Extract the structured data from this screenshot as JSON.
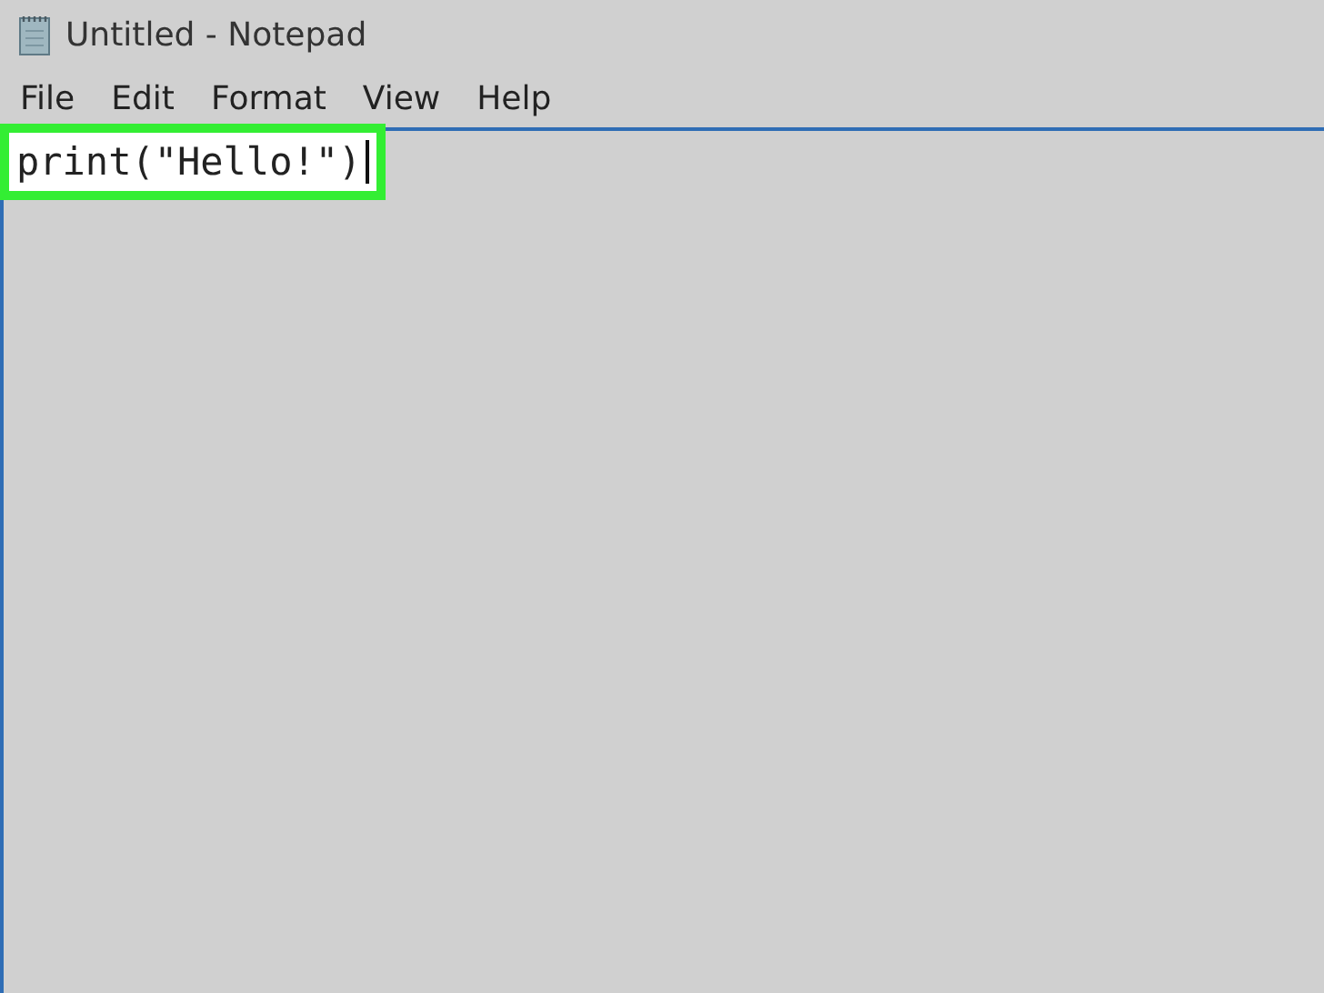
{
  "window": {
    "title": "Untitled - Notepad"
  },
  "menu": [
    "File",
    "Edit",
    "Format",
    "View",
    "Help"
  ],
  "editor": {
    "text": "print(\"Hello!\")",
    "highlighted": true
  }
}
